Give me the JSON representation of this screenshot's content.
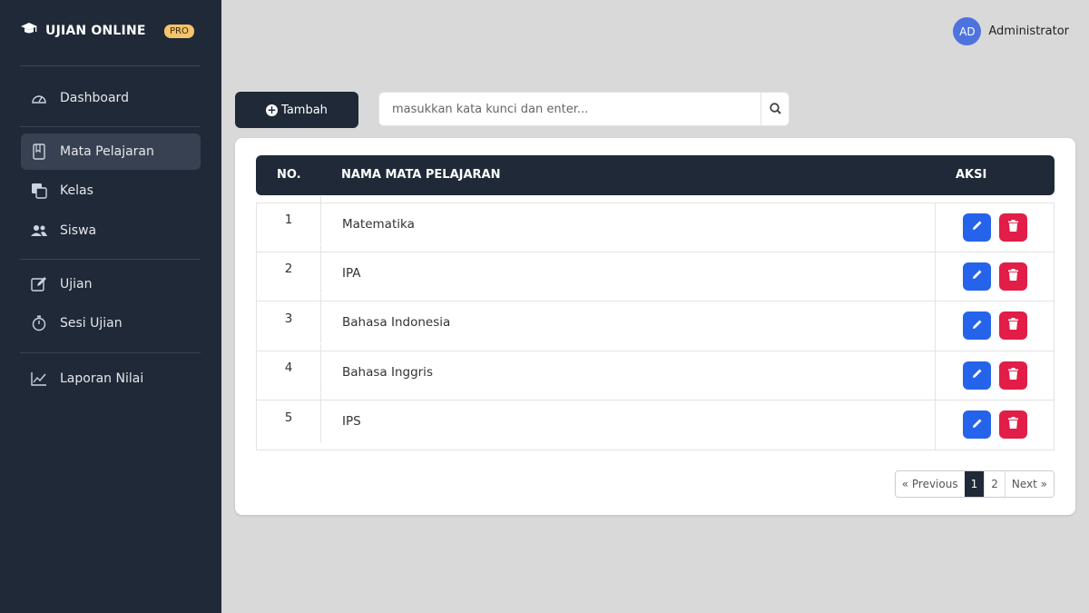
{
  "brand": {
    "name": "UJIAN ONLINE",
    "badge": "PRO"
  },
  "sidebar": {
    "items": [
      {
        "label": "Dashboard",
        "icon": "gauge-icon"
      },
      {
        "label": "Mata Pelajaran",
        "icon": "book-icon",
        "active": true
      },
      {
        "label": "Kelas",
        "icon": "copy-icon"
      },
      {
        "label": "Siswa",
        "icon": "users-icon"
      },
      {
        "label": "Ujian",
        "icon": "edit-icon"
      },
      {
        "label": "Sesi Ujian",
        "icon": "stopwatch-icon"
      },
      {
        "label": "Laporan Nilai",
        "icon": "chart-line-icon"
      }
    ]
  },
  "user": {
    "initials": "AD",
    "name": "Administrator"
  },
  "toolbar": {
    "add_label": "Tambah"
  },
  "search": {
    "placeholder": "masukkan kata kunci dan enter..."
  },
  "table": {
    "headers": [
      "NO.",
      "NAMA MATA PELAJARAN",
      "AKSI"
    ],
    "rows": [
      {
        "no": "1",
        "name": "Matematika"
      },
      {
        "no": "2",
        "name": "IPA"
      },
      {
        "no": "3",
        "name": "Bahasa Indonesia"
      },
      {
        "no": "4",
        "name": "Bahasa Inggris"
      },
      {
        "no": "5",
        "name": "IPS"
      }
    ]
  },
  "pagination": {
    "prev": "« Previous",
    "pages": [
      "1",
      "2"
    ],
    "current": "1",
    "next": "Next »"
  },
  "colors": {
    "sidebar_bg": "#1f2937",
    "accent_blue": "#2563eb",
    "danger_red": "#e11d48",
    "badge": "#f6c36b"
  }
}
